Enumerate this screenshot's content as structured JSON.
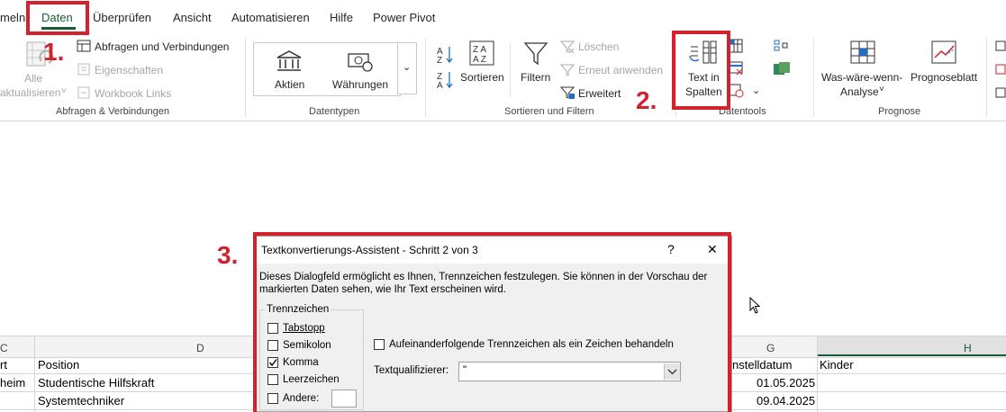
{
  "tabs": [
    "meln",
    "Daten",
    "Überprüfen",
    "Ansicht",
    "Automatisieren",
    "Hilfe",
    "Power Pivot"
  ],
  "ribbon": {
    "refresh_all_line1": "Alle",
    "refresh_all_line2": "aktualisieren",
    "queries_connections": "Abfragen und Verbindungen",
    "properties": "Eigenschaften",
    "workbook_links": "Workbook Links",
    "group_queries": "Abfragen & Verbindungen",
    "stocks": "Aktien",
    "currencies": "Währungen",
    "group_datatypes": "Datentypen",
    "sort": "Sortieren",
    "filter": "Filtern",
    "clear": "Löschen",
    "reapply": "Erneut anwenden",
    "advanced": "Erweitert",
    "group_sortfilter": "Sortieren und Filtern",
    "text_to_columns_line1": "Text in",
    "text_to_columns_line2": "Spalten",
    "group_datatools": "Datentools",
    "whatif_line1": "Was-wäre-wenn-",
    "whatif_line2": "Analyse",
    "forecast_sheet": "Prognoseblatt",
    "group_forecast": "Prognose"
  },
  "annotations": {
    "step1": "1.",
    "step2": "2.",
    "step3": "3."
  },
  "grid": {
    "col_c": "C",
    "col_d": "D",
    "col_g": "G",
    "col_h": "H",
    "row1": {
      "c": "rt",
      "d": "Position",
      "g": "nstelldatum",
      "h": "Kinder"
    },
    "row2": {
      "c": "heim",
      "d": "Studentische Hilfskraft",
      "g": "01.05.2025"
    },
    "row3": {
      "c": "",
      "d": "Systemtechniker",
      "g": "09.04.2025"
    }
  },
  "dialog": {
    "title": "Textkonvertierungs-Assistent - Schritt 2 von 3",
    "help": "?",
    "close": "✕",
    "description_line1": "Dieses Dialogfeld ermöglicht es Ihnen, Trennzeichen festzulegen. Sie können in der Vorschau der",
    "description_line2": "markierten Daten sehen, wie Ihr Text erscheinen wird.",
    "delimiters_legend": "Trennzeichen",
    "delimiters": [
      {
        "label": "Tabstopp",
        "checked": false
      },
      {
        "label": "Semikolon",
        "checked": false
      },
      {
        "label": "Komma",
        "checked": true
      },
      {
        "label": "Leerzeichen",
        "checked": false
      },
      {
        "label": "Andere:",
        "checked": false
      }
    ],
    "consecutive_label": "Aufeinanderfolgende Trennzeichen als ein Zeichen behandeln",
    "consecutive_checked": false,
    "qualifier_label": "Textqualifizierer:",
    "qualifier_value": "\""
  },
  "colors": {
    "accent": "#185c37",
    "annotation_red": "#d1222e"
  }
}
